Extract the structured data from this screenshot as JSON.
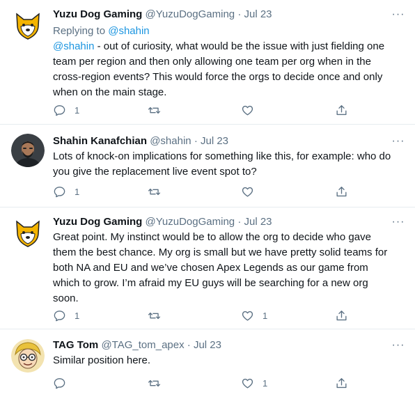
{
  "tweets": [
    {
      "name": "Yuzu Dog Gaming",
      "handle": "@YuzuDogGaming",
      "sep": "·",
      "date": "Jul 23",
      "replying_prefix": "Replying to ",
      "replying_handle": "@shahin",
      "mention": "@shahin",
      "text_lines": [
        " - out of curiosity, what would be the issue with just fielding one",
        "team per region and then only allowing one team per org when in the",
        "cross-region events? This would force the orgs to decide once and only",
        "when on the main stage."
      ],
      "reply_count": "1",
      "retweet_count": "",
      "like_count": "",
      "avatar_icon": "shiba-dog-logo-icon"
    },
    {
      "name": "Shahin Kanafchian",
      "handle": "@shahin",
      "sep": "·",
      "date": "Jul 23",
      "text_lines": [
        "Lots of knock-on implications for something like this, for example: who do",
        "you give the replacement live event spot to?"
      ],
      "reply_count": "1",
      "retweet_count": "",
      "like_count": "",
      "avatar_icon": "profile-photo-icon"
    },
    {
      "name": "Yuzu Dog Gaming",
      "handle": "@YuzuDogGaming",
      "sep": "·",
      "date": "Jul 23",
      "text_lines": [
        "Great point. My instinct would be to allow the org to decide who gave",
        "them the best chance. My org is small but we have pretty solid teams for",
        "both NA and EU and we’ve chosen Apex Legends as our game from",
        "which to grow. I’m afraid my EU guys will be searching for a new org",
        "soon."
      ],
      "reply_count": "1",
      "retweet_count": "",
      "like_count": "1",
      "avatar_icon": "shiba-dog-logo-icon"
    },
    {
      "name": "TAG Tom",
      "handle": "@TAG_tom_apex",
      "sep": "·",
      "date": "Jul 23",
      "text_lines": [
        "Similar position here."
      ],
      "reply_count": "",
      "retweet_count": "",
      "like_count": "1",
      "avatar_icon": "cartoon-avatar-icon"
    }
  ],
  "more_glyph": "···",
  "colors": {
    "link": "#1b95e0",
    "meta": "#5b7083",
    "divider": "#e6ecf0",
    "dog": "#f4b400"
  }
}
